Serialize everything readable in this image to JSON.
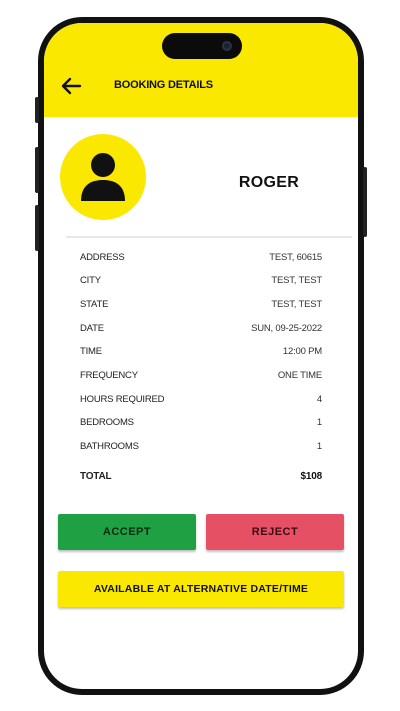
{
  "header": {
    "title": "BOOKING DETAILS"
  },
  "profile": {
    "name": "ROGER"
  },
  "details": [
    {
      "label": "ADDRESS",
      "value": "TEST, 60615"
    },
    {
      "label": "CITY",
      "value": "TEST, TEST"
    },
    {
      "label": "STATE",
      "value": "TEST, TEST"
    },
    {
      "label": "DATE",
      "value": "SUN, 09-25-2022"
    },
    {
      "label": "TIME",
      "value": "12:00 PM"
    },
    {
      "label": "FREQUENCY",
      "value": "ONE TIME"
    },
    {
      "label": "HOURS REQUIRED",
      "value": "4"
    },
    {
      "label": "BEDROOMS",
      "value": "1"
    },
    {
      "label": "BATHROOMS",
      "value": "1"
    }
  ],
  "total": {
    "label": "TOTAL",
    "value": "$108"
  },
  "actions": {
    "accept": "ACCEPT",
    "reject": "REJECT",
    "alternative": "AVAILABLE AT ALTERNATIVE DATE/TIME"
  },
  "colors": {
    "brand_yellow": "#fbe800",
    "accept_green": "#1fa042",
    "reject_red": "#e65065"
  },
  "icons": {
    "back": "arrow-left-icon",
    "avatar": "person-icon"
  }
}
